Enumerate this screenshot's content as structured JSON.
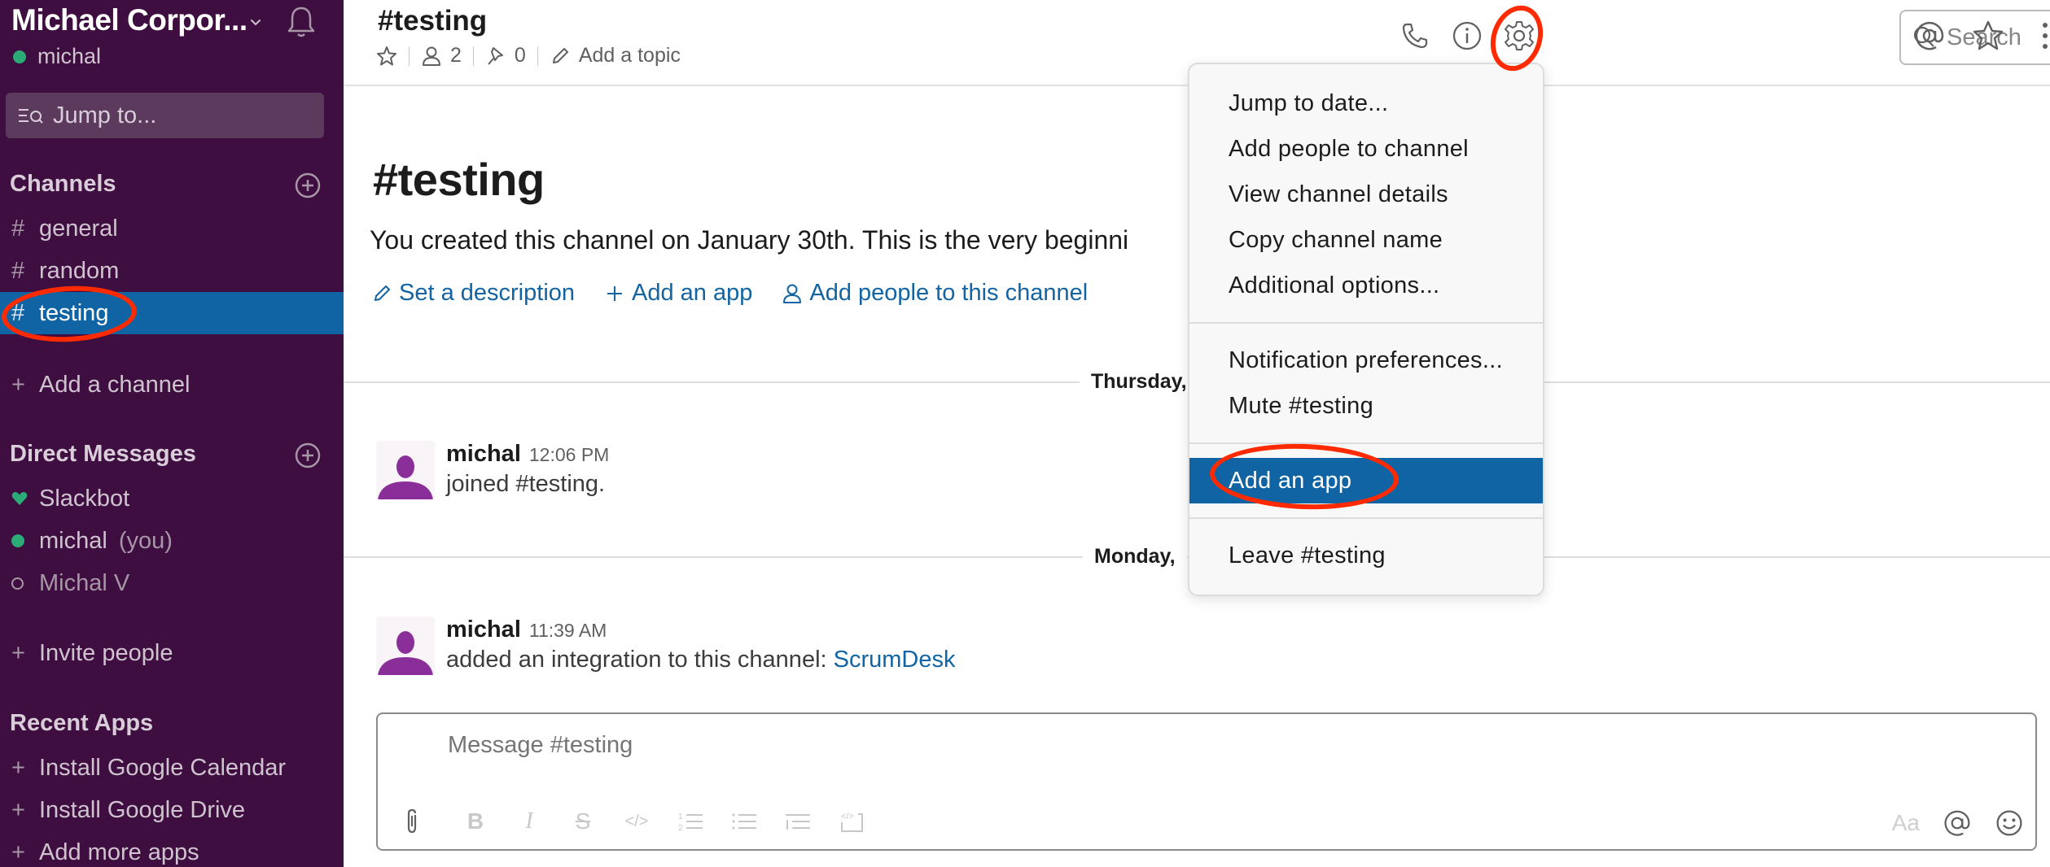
{
  "workspace": {
    "name": "Michael Corpor...",
    "user": "michal",
    "user_status_color": "#2bac76"
  },
  "sidebar": {
    "jump_to": "Jump to...",
    "channels_heading": "Channels",
    "channels": [
      {
        "name": "general",
        "active": false
      },
      {
        "name": "random",
        "active": false
      },
      {
        "name": "testing",
        "active": true
      }
    ],
    "add_channel": "Add a channel",
    "dm_heading": "Direct Messages",
    "dms": [
      {
        "name": "Slackbot",
        "status": "heart"
      },
      {
        "name": "michal",
        "suffix": "(you)",
        "status": "online"
      },
      {
        "name": "Michal V",
        "status": "offline"
      }
    ],
    "invite": "Invite people",
    "apps_heading": "Recent Apps",
    "apps": [
      "Install Google Calendar",
      "Install Google Drive",
      "Add more apps"
    ]
  },
  "header": {
    "channel_title": "#testing",
    "members_count": "2",
    "pins_count": "0",
    "add_topic": "Add a topic",
    "search_placeholder": "Search",
    "icons": [
      "phone-icon",
      "info-icon",
      "gear-icon",
      "mention-icon",
      "star-icon",
      "more-vertical-icon"
    ]
  },
  "intro": {
    "title": "#testing",
    "text": "You created this channel on January 30th. This is the very beginni",
    "actions": [
      {
        "icon": "pencil-icon",
        "label": "Set a description"
      },
      {
        "icon": "plus-icon",
        "label": "Add an app"
      },
      {
        "icon": "person-icon",
        "label": "Add people to this channel"
      }
    ]
  },
  "days": [
    {
      "label": "Thursday,"
    },
    {
      "label": "Monday,"
    }
  ],
  "messages": [
    {
      "author": "michal",
      "time": "12:06 PM",
      "text": "joined #testing.",
      "link": ""
    },
    {
      "author": "michal",
      "time": "11:39 AM",
      "text": "added an integration to this channel: ",
      "link": "ScrumDesk"
    }
  ],
  "composer": {
    "placeholder": "Message #testing",
    "aa_label": "Aa"
  },
  "menu": {
    "groups": [
      [
        "Jump to date...",
        "Add people to channel",
        "View channel details",
        "Copy channel name",
        "Additional options..."
      ],
      [
        "Notification preferences...",
        "Mute #testing"
      ],
      [
        "Add an app"
      ],
      [
        "Leave #testing"
      ]
    ],
    "highlighted": "Add an app"
  },
  "colors": {
    "sidebar_bg": "#3f0e40",
    "active_blue": "#1164a3",
    "link_blue": "#1264a3",
    "annotation_red": "#ff2a00",
    "avatar_purple": "#8a2f9a"
  }
}
